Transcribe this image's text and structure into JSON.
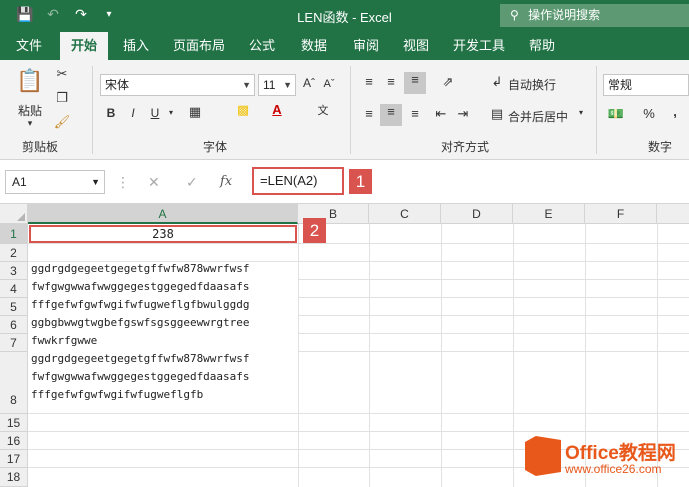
{
  "app": {
    "title": "LEN函数 - Excel",
    "tell_me": "操作说明搜索"
  },
  "tabs": [
    "文件",
    "开始",
    "插入",
    "页面布局",
    "公式",
    "数据",
    "审阅",
    "视图",
    "开发工具",
    "帮助"
  ],
  "ribbon": {
    "clipboard": {
      "label": "剪贴板",
      "paste": "粘贴"
    },
    "font": {
      "label": "字体",
      "name": "宋体",
      "size": "11"
    },
    "alignment": {
      "label": "对齐方式",
      "wrap": "自动换行",
      "merge": "合并后居中"
    },
    "number": {
      "label": "数字",
      "format": "常规",
      "percent": "%",
      "comma": ","
    }
  },
  "formula_bar": {
    "name_box": "A1",
    "fx": "fx",
    "formula": "=LEN(A2)"
  },
  "badges": {
    "b1": "1",
    "b2": "2"
  },
  "columns": [
    "A",
    "B",
    "C",
    "D",
    "E",
    "F"
  ],
  "rows": [
    "1",
    "2",
    "3",
    "4",
    "5",
    "6",
    "7",
    "8",
    "15",
    "16",
    "17",
    "18"
  ],
  "cells": {
    "a1": "238",
    "a2_lines": [
      "ggdrgdgegeetgegetgffwfw878wwrfwsf",
      "fwfgwgwwafwwggegestggegedfdaasafs",
      "fffgefwfgwfwgifwfugweflgfbwulggdg",
      "ggbgbwwgtwgbefgswfsgsggeewwrgtree",
      "fwwkrfgwwe",
      "ggdrgdgegeetgegetgffwfw878wwrfwsf",
      "fwfgwgwwafwwggegestggegedfdaasafs",
      "fffgefwfgwfwgifwfugweflgfb"
    ]
  },
  "watermark": {
    "brand": "Office教程网",
    "url": "www.office26.com"
  }
}
